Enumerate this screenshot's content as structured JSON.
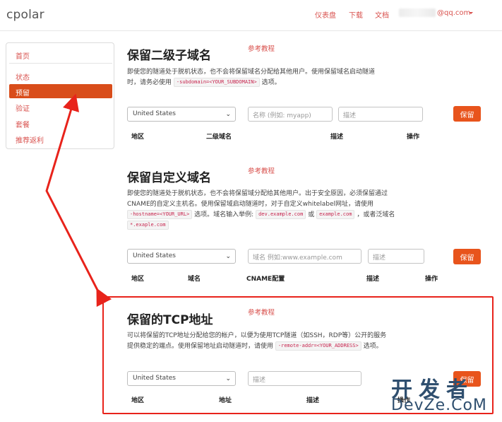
{
  "header": {
    "brand": "cpolar",
    "links": [
      "仪表盘",
      "下载",
      "文档"
    ],
    "user_email": "@qq.com"
  },
  "sidebar": {
    "items": [
      {
        "label": "首页",
        "active": false
      },
      {
        "label": "状态",
        "active": false
      },
      {
        "label": "预留",
        "active": true
      },
      {
        "label": "验证",
        "active": false
      },
      {
        "label": "套餐",
        "active": false
      },
      {
        "label": "推荐返利",
        "active": false
      }
    ]
  },
  "subdomain": {
    "title": "保留二级子域名",
    "ref_link": "参考教程",
    "desc_line1": "即使您的隧道处于脱机状态，也不会将保留域名分配给其他用户。使用保留域名启动隧道",
    "desc_line2_pre": "时，请务必使用",
    "desc_code": "-subdomain=<YOUR_SUBDOMAIN>",
    "desc_line2_post": "选项。",
    "region": "United States",
    "name_placeholder": "名称 (例如: myapp)",
    "desc_placeholder": "描述",
    "save_label": "保留",
    "columns": [
      "地区",
      "二级域名",
      "描述",
      "操作"
    ]
  },
  "custom_domain": {
    "title": "保留自定义域名",
    "ref_link": "参考教程",
    "desc_line1": "即使您的隧道处于脱机状态，也不会将保留域分配给其他用户。出于安全原因，必须保留通过",
    "desc_line2": "CNAME的自定义主机名。使用保留域启动隧道时，对于自定义whitelabel网址，请使用",
    "desc_code1": "-hostname=<YOUR_URL>",
    "desc_line3_a": "选项。域名输入举例:",
    "desc_code2": "dev.example.com",
    "desc_line3_b": "或",
    "desc_code3": "example.com",
    "desc_line3_c": "，或者泛域名",
    "desc_code4": "*.exaple.com",
    "region": "United States",
    "domain_placeholder": "域名 例如:www.example.com",
    "desc_placeholder": "描述",
    "save_label": "保留",
    "columns": [
      "地区",
      "域名",
      "CNAME配置",
      "描述",
      "操作"
    ]
  },
  "tcp": {
    "title": "保留的TCP地址",
    "ref_link": "参考教程",
    "desc_line1": "可以将保留的TCP地址分配给您的帐户，以便为使用TCP隧道（如SSH，RDP等）公开的服务",
    "desc_line2_pre": "提供稳定的端点。使用保留地址启动隧道时，请使用",
    "desc_code": "-remote-addr=<YOUR_ADDRESS>",
    "desc_line2_post": "选项。",
    "region": "United States",
    "desc_placeholder": "描述",
    "save_label": "保留",
    "columns": [
      "地区",
      "地址",
      "描述",
      "操作"
    ]
  },
  "watermark": {
    "cn": "开发者",
    "en": "DevZe.CoM"
  },
  "colors": {
    "accent": "#e8541c",
    "link": "#d9534f",
    "highlight": "#e8231b"
  }
}
